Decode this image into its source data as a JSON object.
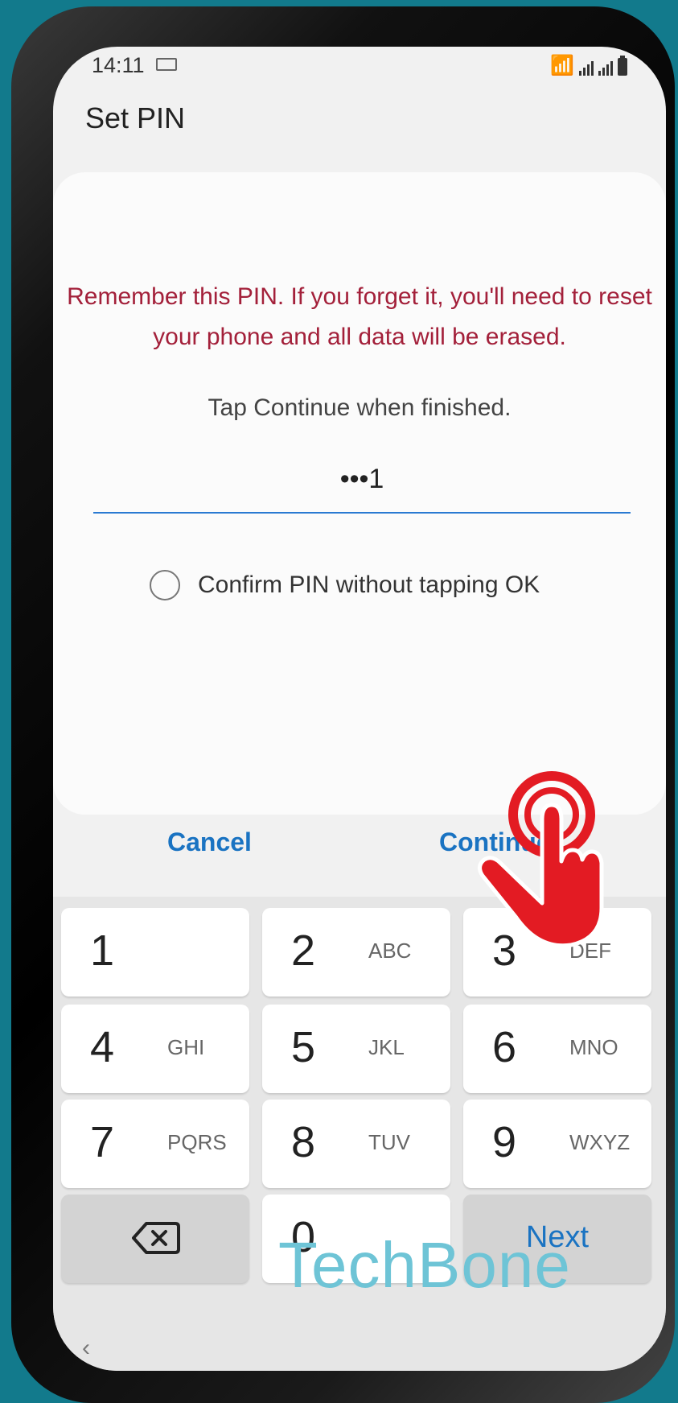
{
  "status": {
    "time": "14:11"
  },
  "header": {
    "title": "Set PIN"
  },
  "card": {
    "warning": "Remember this PIN. If you forget it, you'll need to reset your phone and all data will be erased.",
    "hint": "Tap Continue when finished.",
    "pin_value": "•••1",
    "confirm_label": "Confirm PIN without tapping OK"
  },
  "actions": {
    "cancel": "Cancel",
    "continue": "Continue"
  },
  "keypad": {
    "keys": [
      {
        "digit": "1",
        "letters": ""
      },
      {
        "digit": "2",
        "letters": "ABC"
      },
      {
        "digit": "3",
        "letters": "DEF"
      },
      {
        "digit": "4",
        "letters": "GHI"
      },
      {
        "digit": "5",
        "letters": "JKL"
      },
      {
        "digit": "6",
        "letters": "MNO"
      },
      {
        "digit": "7",
        "letters": "PQRS"
      },
      {
        "digit": "8",
        "letters": "TUV"
      },
      {
        "digit": "9",
        "letters": "WXYZ"
      },
      {
        "digit": "0",
        "letters": ""
      }
    ],
    "next": "Next"
  },
  "watermark": "TechBone",
  "colors": {
    "accent": "#1a73c2",
    "warning": "#a3203a",
    "background": "#127a8c",
    "tap_indicator": "#e31b23"
  }
}
